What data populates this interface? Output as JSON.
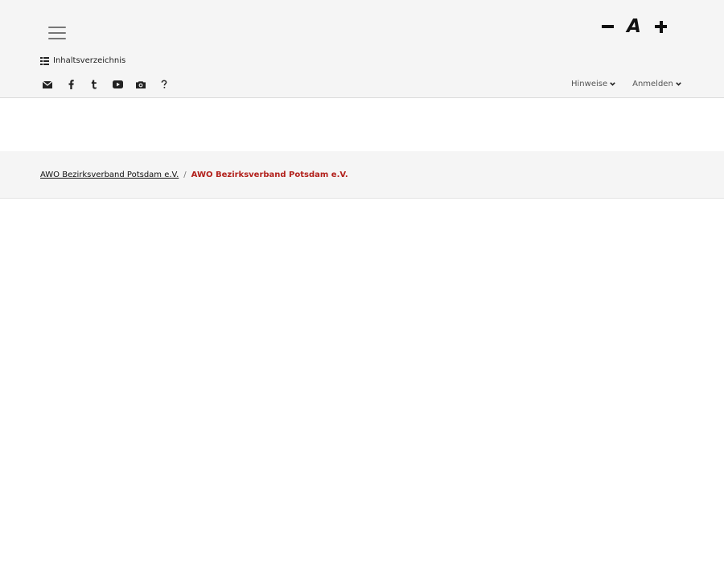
{
  "header": {
    "menu_icon": "hamburger-icon",
    "font_controls": {
      "decrease_icon": "minus-icon",
      "font_icon_label": "A",
      "increase_icon": "plus-icon"
    },
    "toc": {
      "icon": "list-icon",
      "label": "Inhaltsverzeichnis"
    },
    "social_icons": [
      "envelope-icon",
      "facebook-icon",
      "tumblr-icon",
      "youtube-icon",
      "camera-icon",
      "question-icon"
    ],
    "nav": {
      "hinweise_label": "Hinweise",
      "anmelden_label": "Anmelden"
    }
  },
  "breadcrumb": {
    "parent_label": "AWO Bezirksverband Potsdam e.V.",
    "separator": "/",
    "current_label": "AWO Bezirksverband Potsdam e.V."
  },
  "colors": {
    "header_bg": "#f5f5f5",
    "accent_red": "#b2211c"
  }
}
